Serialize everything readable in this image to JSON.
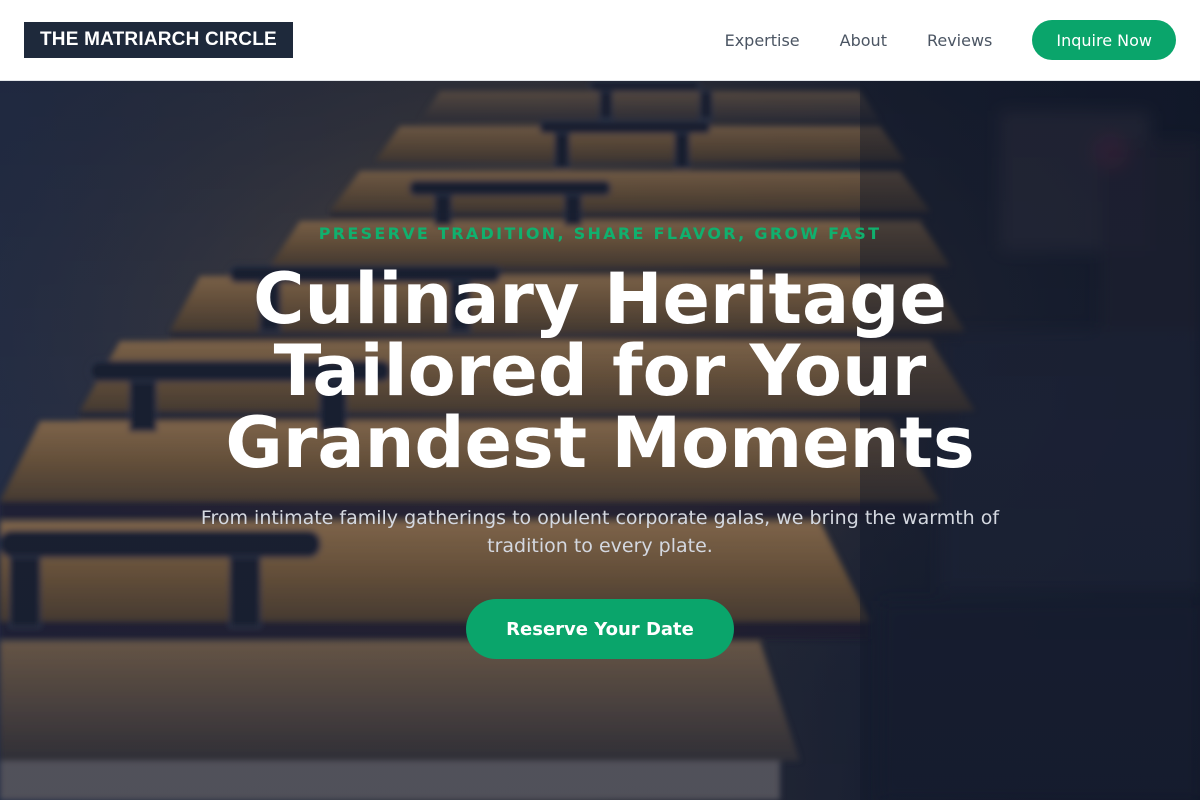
{
  "header": {
    "brand": "THE MATRIARCH CIRCLE",
    "nav": [
      {
        "label": "Expertise"
      },
      {
        "label": "About"
      },
      {
        "label": "Reviews"
      }
    ],
    "cta_label": "Inquire Now"
  },
  "hero": {
    "eyebrow": "PRESERVE TRADITION, SHARE FLAVOR, GROW FAST",
    "headline": "Culinary Heritage Tailored for Your Grandest Moments",
    "subheadline": "From intimate family gatherings to opulent corporate galas, we bring the warmth of tradition to every plate.",
    "cta_label": "Reserve Your Date"
  },
  "colors": {
    "accent": "#0aa56b",
    "brand_bg": "#1e293b",
    "nav_text": "#4b5563"
  }
}
